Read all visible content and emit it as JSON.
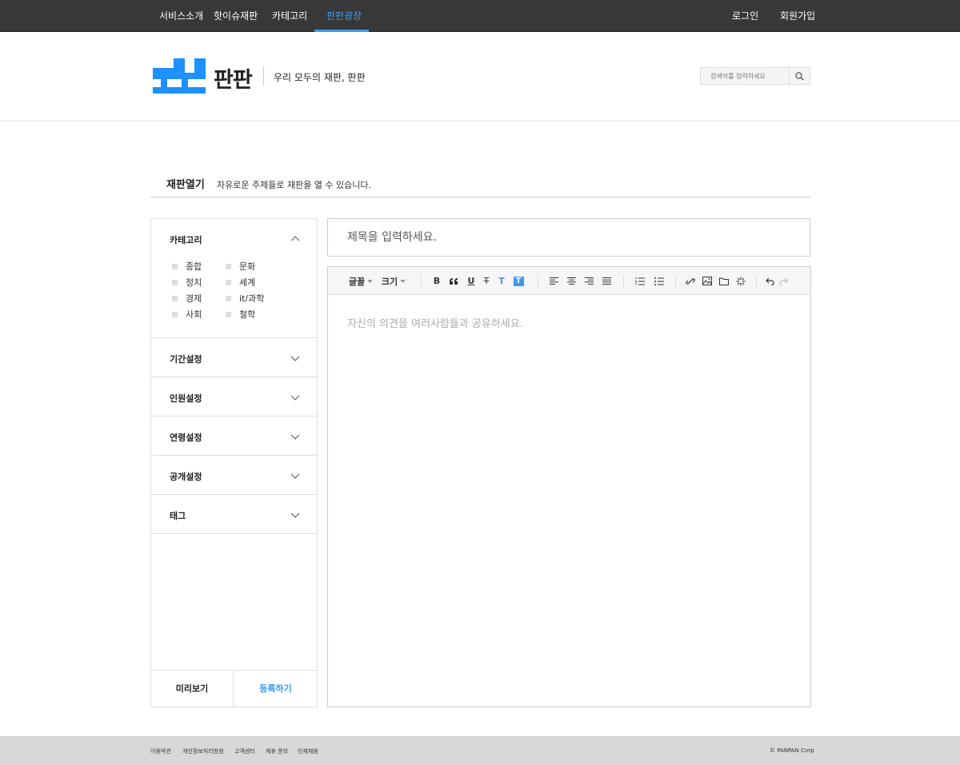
{
  "topnav": {
    "items": [
      "서비스소개",
      "핫이슈재판",
      "카테고리",
      "판판광장"
    ],
    "active_index": 3,
    "login": "로그인",
    "signup": "회원가입"
  },
  "header": {
    "logo_text": "판판",
    "tagline": "우리 모두의 재판, 판판",
    "search_placeholder": "검색어를 입력하세요",
    "brand_color": "#1e90ff"
  },
  "page": {
    "title": "재판열기",
    "description": "자유로운 주제들로 재판을 열 수 있습니다."
  },
  "sidebar": {
    "category": {
      "label": "카테고리",
      "expanded": true,
      "items": [
        "종합",
        "문화",
        "정치",
        "세계",
        "경제",
        "it/과학",
        "사회",
        "철학"
      ]
    },
    "sections": [
      {
        "label": "기간설정"
      },
      {
        "label": "인원설정"
      },
      {
        "label": "연령설정"
      },
      {
        "label": "공개설정"
      },
      {
        "label": "태그"
      }
    ],
    "preview_label": "미리보기",
    "submit_label": "등록하기"
  },
  "editor": {
    "title_placeholder": "제목을 입력하세요.",
    "body_placeholder": "자신의 의견을 여러사람들과 공유하세요.",
    "toolbar": {
      "font_label": "글꼴",
      "size_label": "크기",
      "icons": [
        "bold-icon",
        "quote-icon",
        "underline-icon",
        "strikethrough-icon",
        "text-color-icon",
        "text-background-icon",
        "align-left-icon",
        "align-center-icon",
        "align-right-icon",
        "align-justify-icon",
        "ordered-list-icon",
        "unordered-list-icon",
        "link-icon",
        "image-icon",
        "folder-icon",
        "special-char-icon",
        "undo-icon",
        "redo-icon"
      ]
    }
  },
  "footer": {
    "links": [
      "이용약관",
      "개인정보처리방침",
      "고객센터",
      "제휴 문의",
      "인재채용"
    ],
    "copyright": "© PANPAN Corp"
  },
  "colors": {
    "accent": "#3a9bef",
    "nav_bg": "#383838",
    "footer_bg": "#d8d8d8"
  }
}
